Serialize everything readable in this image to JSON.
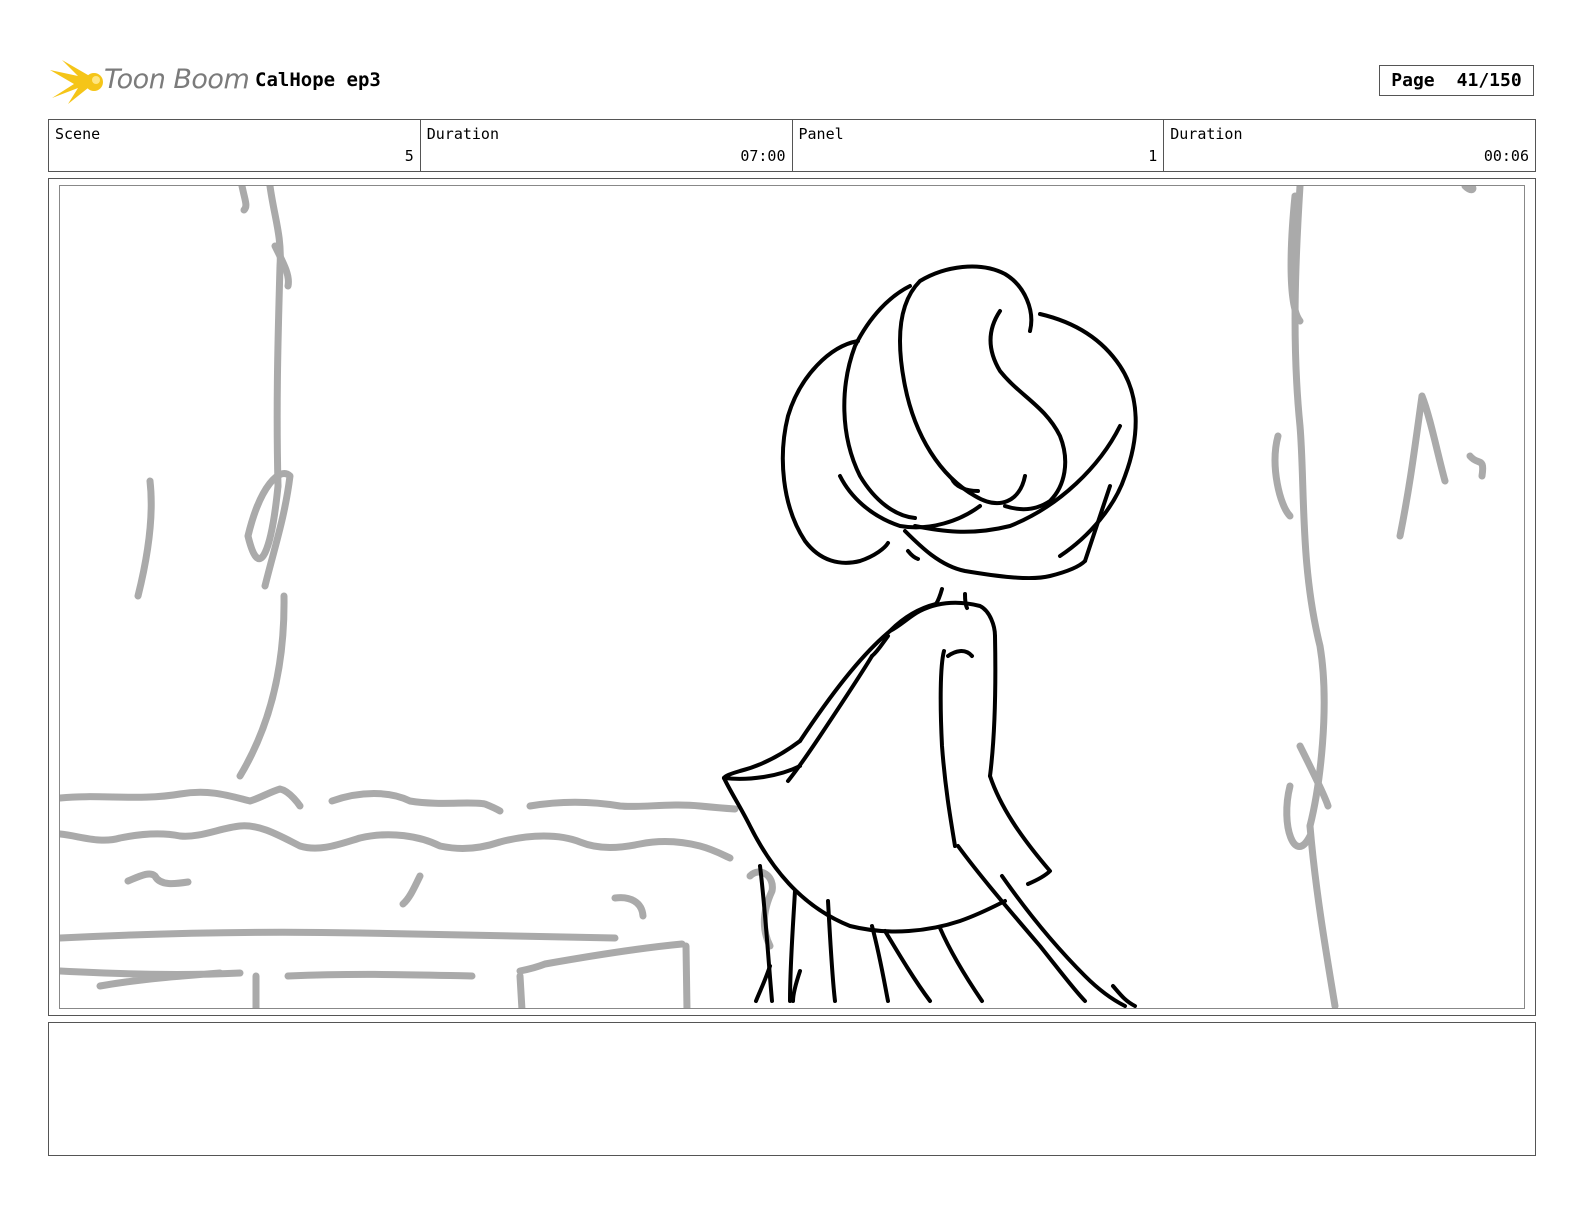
{
  "header": {
    "logo_text": "Toon Boom",
    "project_title": "CalHope ep3",
    "page_label": "Page",
    "page_number": "41/150"
  },
  "info": {
    "scene_label": "Scene",
    "scene_value": "5",
    "scene_duration_label": "Duration",
    "scene_duration_value": "07:00",
    "panel_label": "Panel",
    "panel_value": "1",
    "panel_duration_label": "Duration",
    "panel_duration_value": "00:06"
  },
  "colors": {
    "logo_accent": "#f5c518",
    "sketch_lines": "#000000",
    "background_lines": "#aaaaaa"
  },
  "notes": {
    "text": ""
  }
}
